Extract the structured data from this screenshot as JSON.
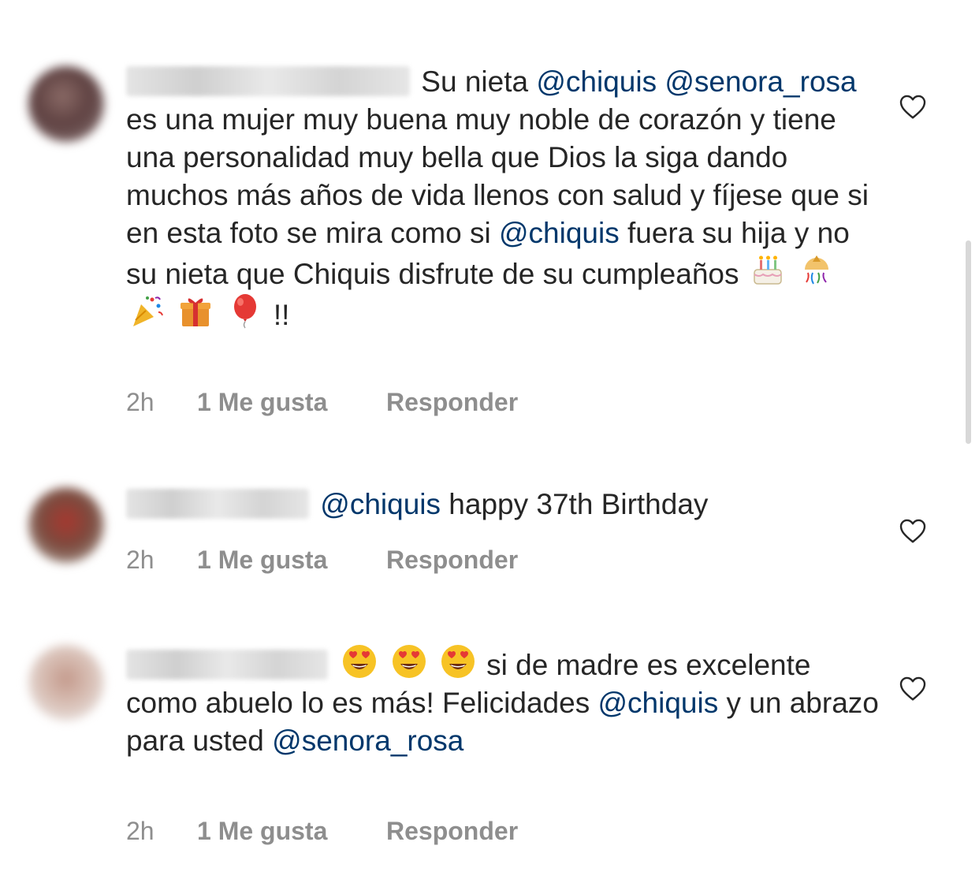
{
  "comments": [
    {
      "text_a": "Su nieta",
      "mention_a": "@chiquis",
      "mention_b": "@senora_rosa",
      "text_b": "es una mujer muy buena muy noble de corazón y tiene una personalidad muy bella que Dios la siga dando muchos más años de vida llenos con salud y fíjese que si en esta foto se mira como si",
      "mention_c": "@chiquis",
      "text_c": "fuera su hija y no su nieta que Chiquis disfrute de su cumpleaños",
      "text_d": "!!",
      "time": "2h",
      "likes": "1 Me gusta",
      "reply": "Responder"
    },
    {
      "mention_a": "@chiquis",
      "text_a": "happy 37th Birthday",
      "time": "2h",
      "likes": "1 Me gusta",
      "reply": "Responder"
    },
    {
      "text_a": "si de madre es excelente como abuelo lo es más! Felicidades",
      "mention_a": "@chiquis",
      "text_b": " y un abrazo para usted",
      "mention_b": "@senora_rosa",
      "time": "2h",
      "likes": "1 Me gusta",
      "reply": "Responder"
    }
  ],
  "icons": {
    "like": "heart-outline-icon",
    "emojis_comment_1": [
      "birthday-cake-emoji",
      "confetti-ball-emoji",
      "party-popper-emoji",
      "wrapped-gift-emoji",
      "balloon-emoji"
    ],
    "emojis_comment_3": [
      "heart-eyes-emoji",
      "heart-eyes-emoji",
      "heart-eyes-emoji"
    ]
  },
  "colors": {
    "text": "#262626",
    "mention": "#00376b",
    "meta": "#8e8e8e"
  }
}
